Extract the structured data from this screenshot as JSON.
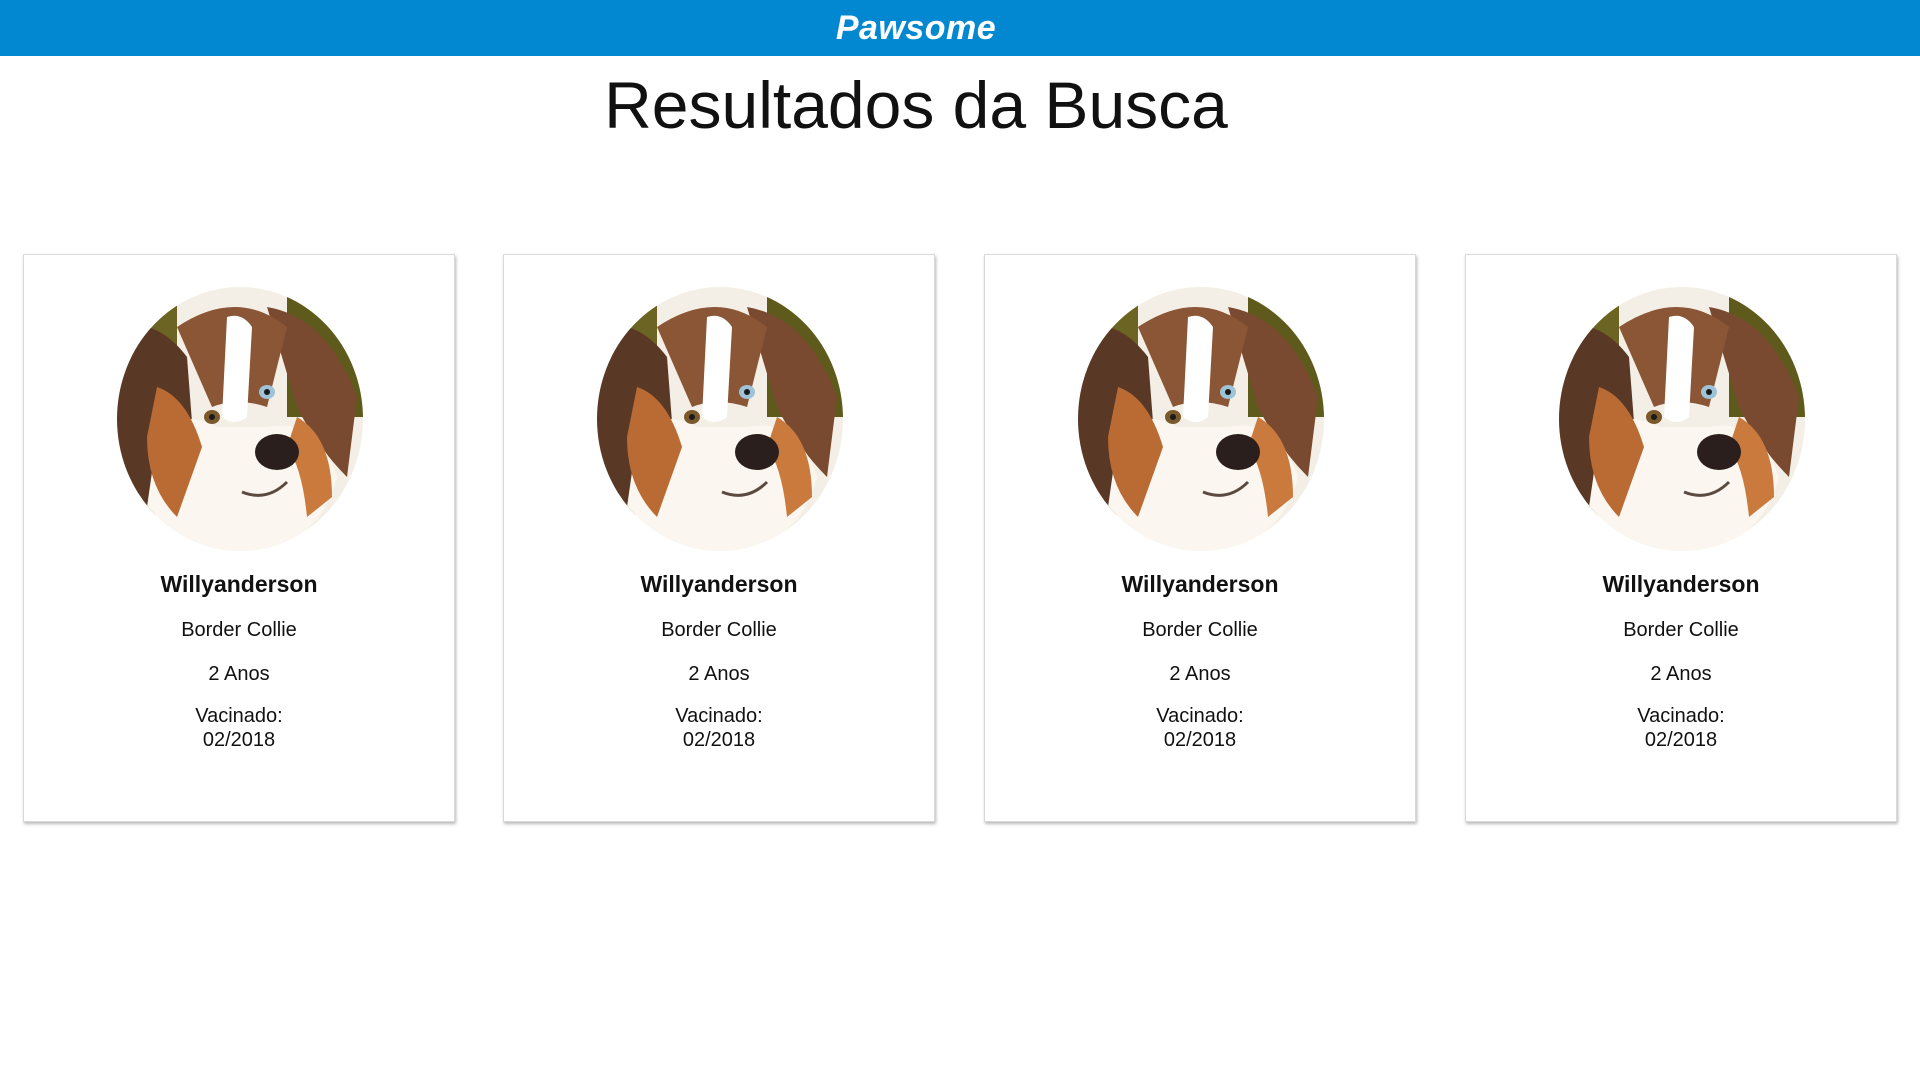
{
  "header": {
    "brand": "Pawsome",
    "background_color": "#0288d1"
  },
  "page": {
    "title": "Resultados da Busca"
  },
  "results": [
    {
      "photo_icon": "dog-photo",
      "name": "Willyanderson",
      "breed": "Border Collie",
      "age": "2 Anos",
      "vaccine_label": "Vacinado:",
      "vaccine_date": "02/2018"
    },
    {
      "photo_icon": "dog-photo",
      "name": "Willyanderson",
      "breed": "Border Collie",
      "age": "2 Anos",
      "vaccine_label": "Vacinado:",
      "vaccine_date": "02/2018"
    },
    {
      "photo_icon": "dog-photo",
      "name": "Willyanderson",
      "breed": "Border Collie",
      "age": "2 Anos",
      "vaccine_label": "Vacinado:",
      "vaccine_date": "02/2018"
    },
    {
      "photo_icon": "dog-photo",
      "name": "Willyanderson",
      "breed": "Border Collie",
      "age": "2 Anos",
      "vaccine_label": "Vacinado:",
      "vaccine_date": "02/2018"
    }
  ]
}
